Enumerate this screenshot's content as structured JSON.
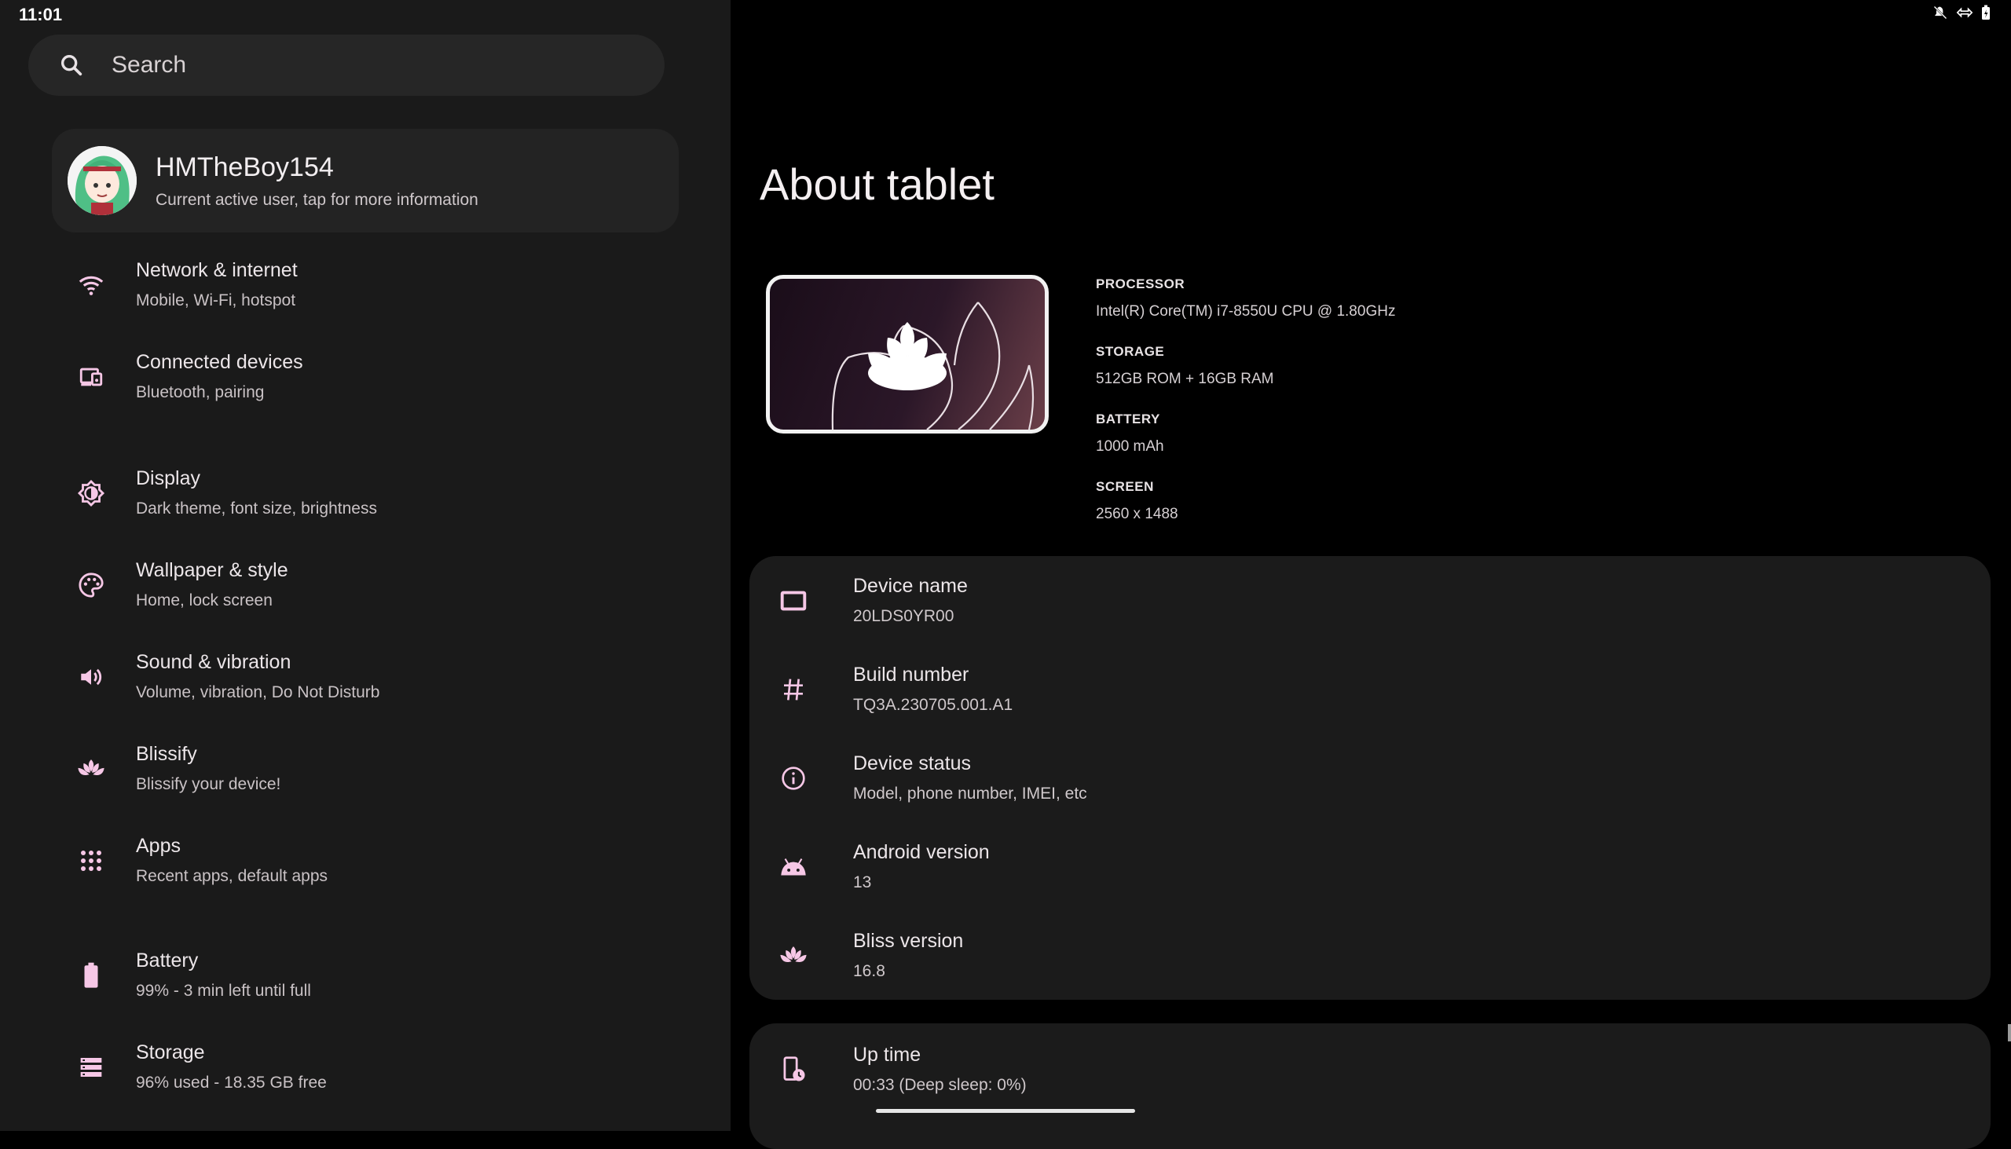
{
  "status": {
    "time": "11:01"
  },
  "search": {
    "placeholder": "Search"
  },
  "user": {
    "name": "HMTheBoy154",
    "subtitle": "Current active user, tap for more information"
  },
  "menu": [
    {
      "title": "Network & internet",
      "subtitle": "Mobile, Wi-Fi, hotspot",
      "icon": "wifi-icon"
    },
    {
      "title": "Connected devices",
      "subtitle": "Bluetooth, pairing",
      "icon": "devices-icon"
    },
    {
      "title": "Display",
      "subtitle": "Dark theme, font size, brightness",
      "icon": "brightness-icon"
    },
    {
      "title": "Wallpaper & style",
      "subtitle": "Home, lock screen",
      "icon": "palette-icon"
    },
    {
      "title": "Sound & vibration",
      "subtitle": "Volume, vibration, Do Not Disturb",
      "icon": "volume-icon"
    },
    {
      "title": "Blissify",
      "subtitle": "Blissify your device!",
      "icon": "lotus-icon"
    },
    {
      "title": "Apps",
      "subtitle": "Recent apps, default apps",
      "icon": "apps-grid-icon"
    },
    {
      "title": "Battery",
      "subtitle": "99% - 3 min left until full",
      "icon": "battery-icon"
    },
    {
      "title": "Storage",
      "subtitle": "96% used - 18.35 GB free",
      "icon": "storage-icon"
    }
  ],
  "about": {
    "title": "About tablet",
    "specs": [
      {
        "label": "PROCESSOR",
        "value": "Intel(R) Core(TM) i7-8550U CPU @ 1.80GHz"
      },
      {
        "label": "STORAGE",
        "value": "512GB ROM + 16GB RAM"
      },
      {
        "label": "BATTERY",
        "value": "1000 mAh"
      },
      {
        "label": "SCREEN",
        "value": "2560 x 1488"
      }
    ],
    "rows": [
      {
        "title": "Device name",
        "value": "20LDS0YR00",
        "icon": "tablet-icon"
      },
      {
        "title": "Build number",
        "value": "TQ3A.230705.001.A1",
        "icon": "hash-icon"
      },
      {
        "title": "Device status",
        "value": "Model, phone number, IMEI, etc",
        "icon": "info-icon"
      },
      {
        "title": "Android version",
        "value": "13",
        "icon": "android-icon"
      },
      {
        "title": "Bliss version",
        "value": "16.8",
        "icon": "lotus-icon"
      }
    ],
    "uptime": {
      "title": "Up time",
      "value": "00:33 (Deep sleep: 0%)",
      "icon": "uptime-icon"
    }
  },
  "colors": {
    "accent": "#f6c7e6",
    "left_bg": "#1a1a1a",
    "card_bg": "#1b1b1b"
  }
}
